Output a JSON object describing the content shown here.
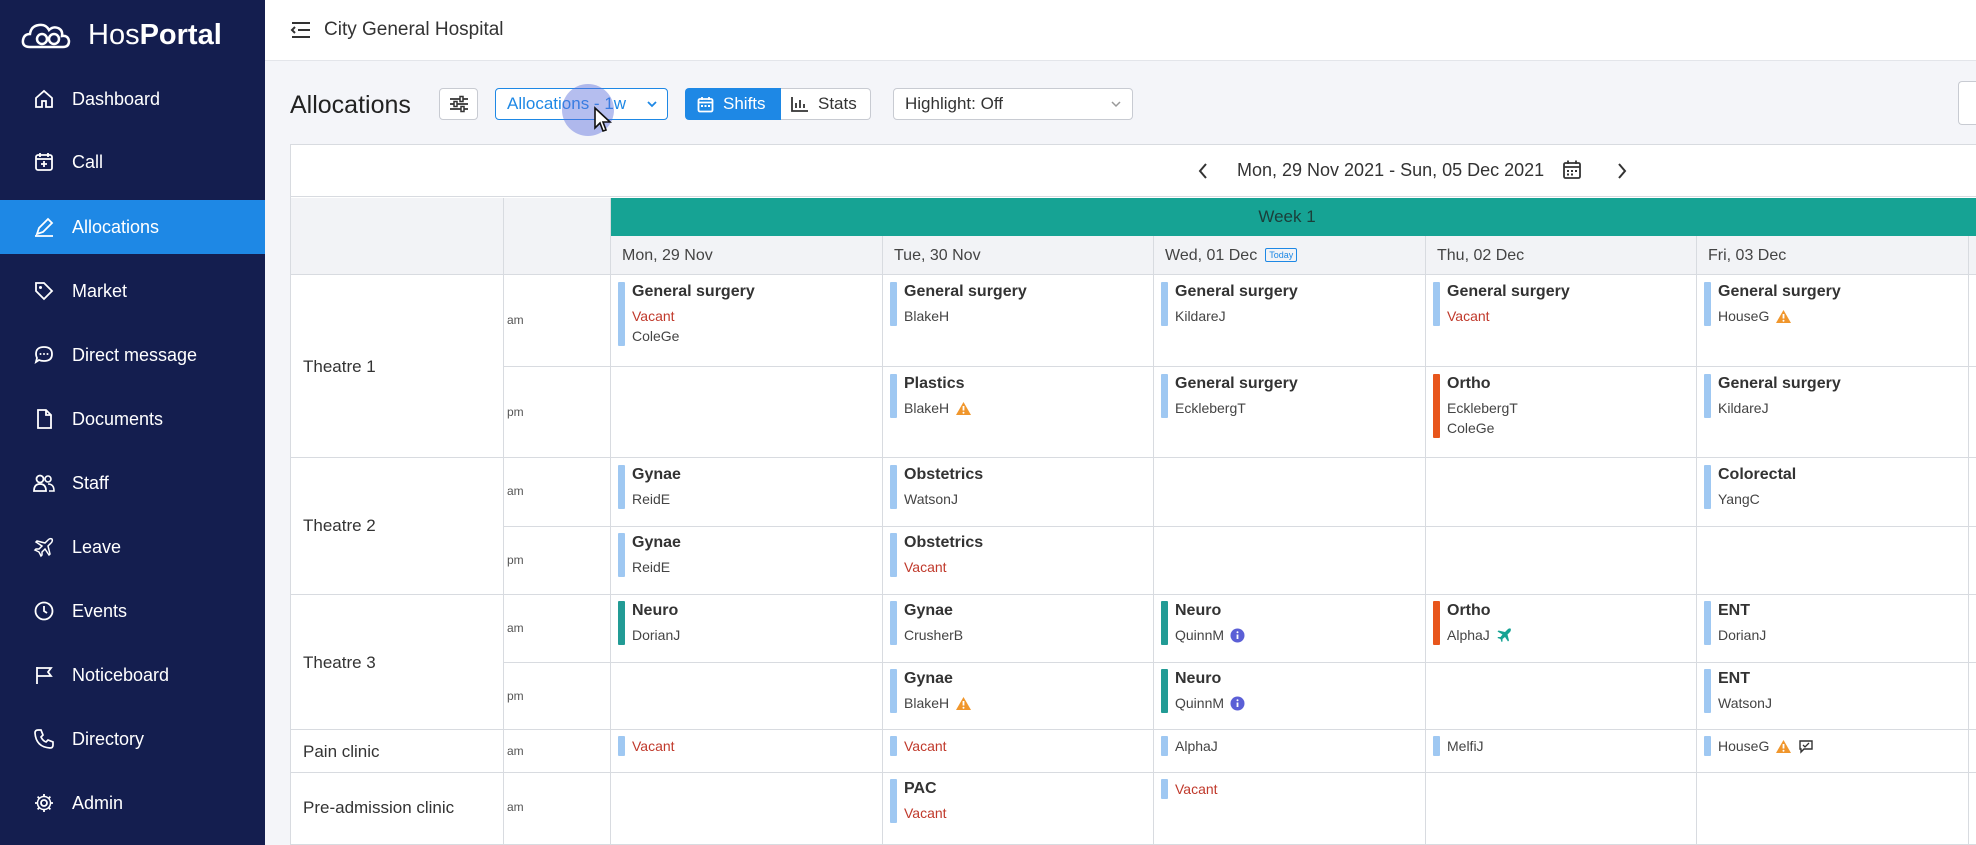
{
  "app": {
    "brand_light": "Hos",
    "brand_bold": "Portal"
  },
  "sidebar": {
    "items": [
      {
        "label": "Dashboard",
        "icon": "home-icon"
      },
      {
        "label": "Call",
        "icon": "calendar-plus-icon"
      },
      {
        "label": "Allocations",
        "icon": "pen-icon",
        "active": true
      },
      {
        "label": "Market",
        "icon": "tag-icon"
      },
      {
        "label": "Direct message",
        "icon": "chat-icon"
      },
      {
        "label": "Documents",
        "icon": "document-icon"
      },
      {
        "label": "Staff",
        "icon": "users-icon"
      },
      {
        "label": "Leave",
        "icon": "plane-icon"
      },
      {
        "label": "Events",
        "icon": "clock-icon"
      },
      {
        "label": "Noticeboard",
        "icon": "flag-icon"
      },
      {
        "label": "Directory",
        "icon": "phone-icon"
      },
      {
        "label": "Admin",
        "icon": "gear-icon"
      }
    ]
  },
  "topbar": {
    "hospital": "City General Hospital"
  },
  "toolbar": {
    "title": "Allocations",
    "view_select": "Allocations - 1w",
    "shifts_label": "Shifts",
    "stats_label": "Stats",
    "highlight": "Highlight: Off"
  },
  "calendar": {
    "range": "Mon, 29 Nov 2021 - Sun, 05 Dec 2021",
    "week_label": "Week 1",
    "today_badge": "Today",
    "days": [
      "Mon, 29 Nov",
      "Tue, 30 Nov",
      "Wed, 01 Dec",
      "Thu, 02 Dec",
      "Fri, 03 Dec"
    ],
    "theatres": [
      "Theatre 1",
      "Theatre 2",
      "Theatre 3",
      "Pain clinic",
      "Pre-admission clinic"
    ],
    "sessions": [
      "am",
      "pm",
      "am",
      "pm",
      "am",
      "pm",
      "am",
      "am"
    ],
    "shifts": {
      "t1_am_mon": {
        "title": "General surgery",
        "staff": [
          "Vacant",
          "ColeGe"
        ]
      },
      "t1_am_tue": {
        "title": "General surgery",
        "staff": [
          "BlakeH"
        ]
      },
      "t1_am_wed": {
        "title": "General surgery",
        "staff": [
          "KildareJ"
        ]
      },
      "t1_am_thu": {
        "title": "General surgery",
        "staff": [
          "Vacant"
        ]
      },
      "t1_am_fri": {
        "title": "General surgery",
        "staff": [
          "HouseG"
        ]
      },
      "t1_pm_tue": {
        "title": "Plastics",
        "staff": [
          "BlakeH"
        ]
      },
      "t1_pm_wed": {
        "title": "General surgery",
        "staff": [
          "EcklebergT"
        ]
      },
      "t1_pm_thu": {
        "title": "Ortho",
        "staff": [
          "EcklebergT",
          "ColeGe"
        ]
      },
      "t1_pm_fri": {
        "title": "General surgery",
        "staff": [
          "KildareJ"
        ]
      },
      "t2_am_mon": {
        "title": "Gynae",
        "staff": [
          "ReidE"
        ]
      },
      "t2_am_tue": {
        "title": "Obstetrics",
        "staff": [
          "WatsonJ"
        ]
      },
      "t2_am_fri": {
        "title": "Colorectal",
        "staff": [
          "YangC"
        ]
      },
      "t2_pm_mon": {
        "title": "Gynae",
        "staff": [
          "ReidE"
        ]
      },
      "t2_pm_tue": {
        "title": "Obstetrics",
        "staff": [
          "Vacant"
        ]
      },
      "t3_am_mon": {
        "title": "Neuro",
        "staff": [
          "DorianJ"
        ]
      },
      "t3_am_tue": {
        "title": "Gynae",
        "staff": [
          "CrusherB"
        ]
      },
      "t3_am_wed": {
        "title": "Neuro",
        "staff": [
          "QuinnM"
        ]
      },
      "t3_am_thu": {
        "title": "Ortho",
        "staff": [
          "AlphaJ"
        ]
      },
      "t3_am_fri": {
        "title": "ENT",
        "staff": [
          "DorianJ"
        ]
      },
      "t3_pm_tue": {
        "title": "Gynae",
        "staff": [
          "BlakeH"
        ]
      },
      "t3_pm_wed": {
        "title": "Neuro",
        "staff": [
          "QuinnM"
        ]
      },
      "t3_pm_fri": {
        "title": "ENT",
        "staff": [
          "WatsonJ"
        ]
      },
      "pc_mon": {
        "staff": [
          "Vacant"
        ]
      },
      "pc_tue": {
        "staff": [
          "Vacant"
        ]
      },
      "pc_wed": {
        "staff": [
          "AlphaJ"
        ]
      },
      "pc_thu": {
        "staff": [
          "MelfiJ"
        ]
      },
      "pc_fri": {
        "staff": [
          "HouseG"
        ]
      },
      "pac_tue": {
        "title": "PAC",
        "staff": [
          "Vacant"
        ]
      },
      "pac_wed": {
        "staff": [
          "Vacant"
        ]
      }
    }
  },
  "colors": {
    "sidebar_bg": "#141e4f",
    "accent": "#1e88e5",
    "week_band": "#16a394",
    "bar_light_blue": "#9fc8f2",
    "bar_teal": "#229b95",
    "bar_orange": "#e8561c",
    "vacant_text": "#c0392b",
    "warning": "#f0962c",
    "info": "#5b5fd6"
  }
}
